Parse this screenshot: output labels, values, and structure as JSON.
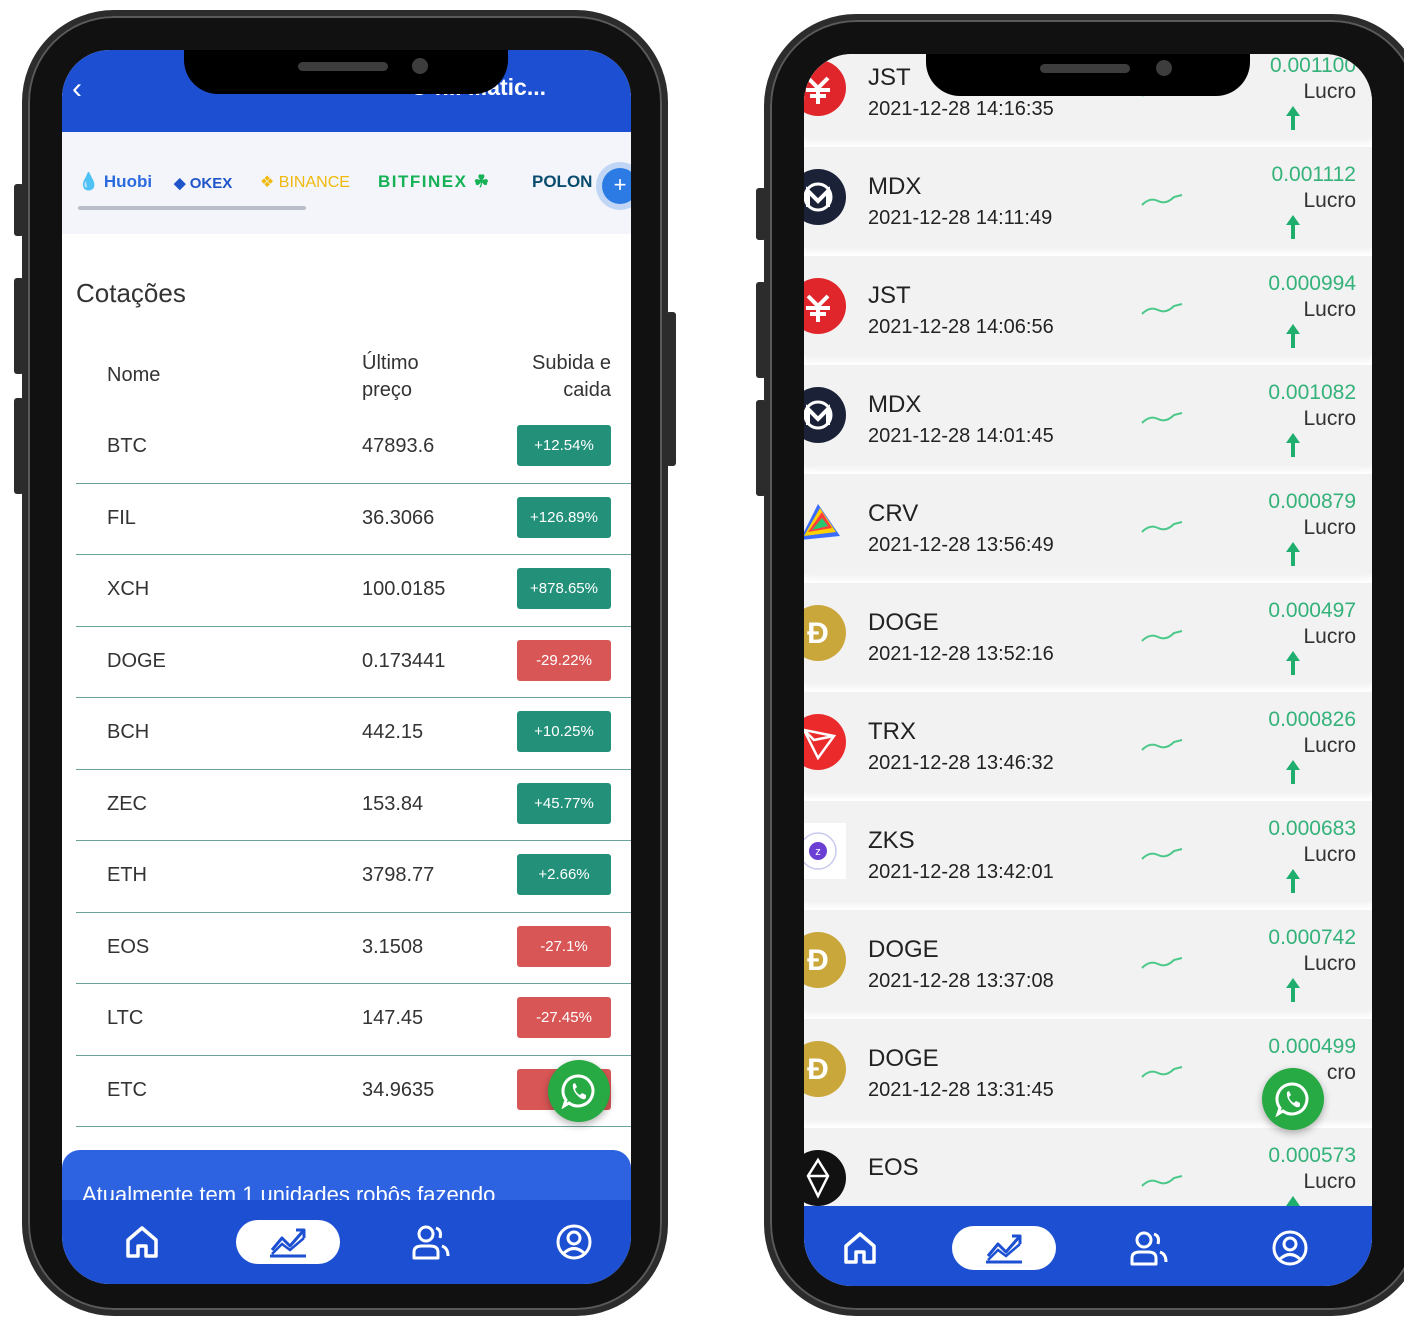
{
  "left": {
    "header_title": "O r... ...atic...",
    "exchanges": [
      "Huobi",
      "OKEX",
      "BINANCE",
      "BITFINEX",
      "POLON"
    ],
    "section_title": "Cotações",
    "table_headers": {
      "name": "Nome",
      "price": "Último preço",
      "change": "Subida e caida"
    },
    "rows": [
      {
        "name": "BTC",
        "price": "47893.6",
        "change": "+12.54%",
        "dir": "up"
      },
      {
        "name": "FIL",
        "price": "36.3066",
        "change": "+126.89%",
        "dir": "up"
      },
      {
        "name": "XCH",
        "price": "100.0185",
        "change": "+878.65%",
        "dir": "up"
      },
      {
        "name": "DOGE",
        "price": "0.173441",
        "change": "-29.22%",
        "dir": "down"
      },
      {
        "name": "BCH",
        "price": "442.15",
        "change": "+10.25%",
        "dir": "up"
      },
      {
        "name": "ZEC",
        "price": "153.84",
        "change": "+45.77%",
        "dir": "up"
      },
      {
        "name": "ETH",
        "price": "3798.77",
        "change": "+2.66%",
        "dir": "up"
      },
      {
        "name": "EOS",
        "price": "3.1508",
        "change": "-27.1%",
        "dir": "down"
      },
      {
        "name": "LTC",
        "price": "147.45",
        "change": "-27.45%",
        "dir": "down"
      },
      {
        "name": "ETC",
        "price": "34.9635",
        "change": "-2",
        "dir": "down"
      }
    ],
    "banner_text": "Atualmente tem 1 unidades robôs fazendo"
  },
  "right": {
    "trades": [
      {
        "symbol": "JST",
        "time": "2021-12-28 14:16:35",
        "profit": "0.001100",
        "label": "Lucro",
        "icon": "jst-icon"
      },
      {
        "symbol": "MDX",
        "time": "2021-12-28 14:11:49",
        "profit": "0.001112",
        "label": "Lucro",
        "icon": "mdx-icon"
      },
      {
        "symbol": "JST",
        "time": "2021-12-28 14:06:56",
        "profit": "0.000994",
        "label": "Lucro",
        "icon": "jst-icon"
      },
      {
        "symbol": "MDX",
        "time": "2021-12-28 14:01:45",
        "profit": "0.001082",
        "label": "Lucro",
        "icon": "mdx-icon"
      },
      {
        "symbol": "CRV",
        "time": "2021-12-28 13:56:49",
        "profit": "0.000879",
        "label": "Lucro",
        "icon": "crv-icon"
      },
      {
        "symbol": "DOGE",
        "time": "2021-12-28 13:52:16",
        "profit": "0.000497",
        "label": "Lucro",
        "icon": "doge-icon"
      },
      {
        "symbol": "TRX",
        "time": "2021-12-28 13:46:32",
        "profit": "0.000826",
        "label": "Lucro",
        "icon": "trx-icon"
      },
      {
        "symbol": "ZKS",
        "time": "2021-12-28 13:42:01",
        "profit": "0.000683",
        "label": "Lucro",
        "icon": "zks-icon"
      },
      {
        "symbol": "DOGE",
        "time": "2021-12-28 13:37:08",
        "profit": "0.000742",
        "label": "Lucro",
        "icon": "doge-icon"
      },
      {
        "symbol": "DOGE",
        "time": "2021-12-28 13:31:45",
        "profit": "0.000499",
        "label": "cro",
        "icon": "doge-icon"
      },
      {
        "symbol": "EOS",
        "time": "",
        "profit": "0.000573",
        "label": "Lucro",
        "icon": "eos-icon"
      }
    ]
  },
  "colors": {
    "brand_blue": "#1c4fd2",
    "up_green": "#23917a",
    "down_red": "#d95656",
    "profit_green": "#34b27a",
    "whatsapp_green": "#27a944"
  }
}
